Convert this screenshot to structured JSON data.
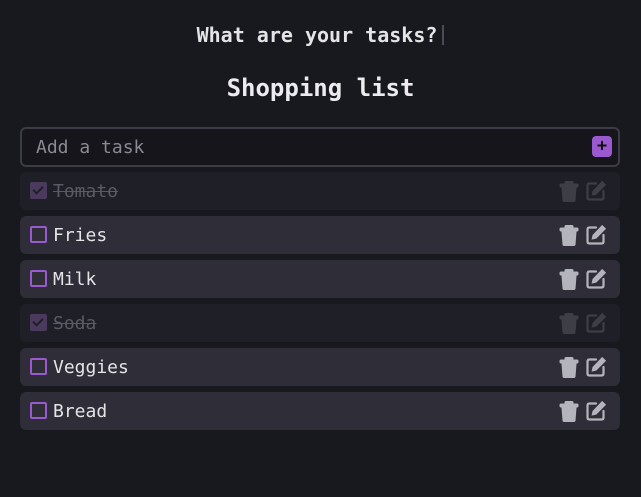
{
  "header": {
    "prompt": "What are your tasks?",
    "list_title": "Shopping list"
  },
  "add_task": {
    "placeholder": "Add a task",
    "value": "",
    "button_label": "+"
  },
  "icons": {
    "delete": "trash-icon",
    "edit": "edit-icon",
    "done": "checkmark-icon"
  },
  "colors": {
    "accent": "#9b59d0",
    "background": "#18181f",
    "row": "#2e2d38",
    "row_done": "#1f1f27"
  },
  "tasks": [
    {
      "label": "Tomato",
      "done": true
    },
    {
      "label": "Fries",
      "done": false
    },
    {
      "label": "Milk",
      "done": false
    },
    {
      "label": "Soda",
      "done": true
    },
    {
      "label": "Veggies",
      "done": false
    },
    {
      "label": "Bread",
      "done": false
    }
  ]
}
